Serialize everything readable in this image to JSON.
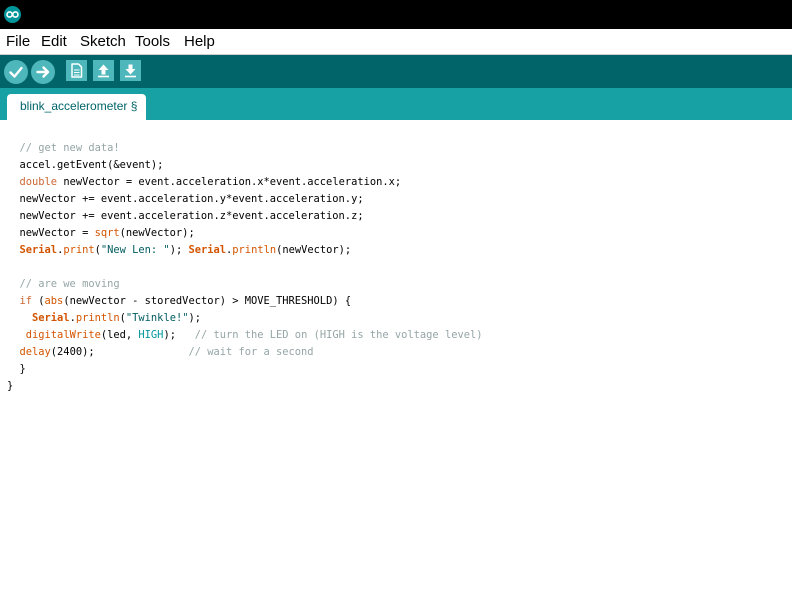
{
  "app": {
    "logo_icon": "arduino-infinity-logo-icon",
    "colors": {
      "toolbar": "#006468",
      "tabbar": "#17a1a5",
      "button": "#4db7bb",
      "keyword": "#cc6633",
      "comment": "#95a5a6",
      "string": "#005c5f",
      "constant": "#00979c"
    }
  },
  "menu": {
    "file": "File",
    "edit": "Edit",
    "sketch": "Sketch",
    "tools": "Tools",
    "help": "Help"
  },
  "toolbar": {
    "buttons": [
      {
        "name": "verify",
        "icon": "checkmark-icon"
      },
      {
        "name": "upload",
        "icon": "right-arrow-icon"
      },
      {
        "name": "new",
        "icon": "new-document-icon"
      },
      {
        "name": "open",
        "icon": "up-arrow-icon"
      },
      {
        "name": "save",
        "icon": "down-arrow-icon"
      }
    ]
  },
  "tab": {
    "label": "blink_accelerometer §"
  },
  "code": {
    "l1": {
      "a": "  // get new data!"
    },
    "l2": {
      "a": "  accel.getEvent(&event);"
    },
    "l3": {
      "a": "  ",
      "b": "double",
      "c": " newVector = event.acceleration.x*event.acceleration.x;"
    },
    "l4": {
      "a": "  newVector += event.acceleration.y*event.acceleration.y;"
    },
    "l5": {
      "a": "  newVector += event.acceleration.z*event.acceleration.z;"
    },
    "l6": {
      "a": "  newVector = ",
      "b": "sqrt",
      "c": "(newVector);"
    },
    "l7": {
      "a": "  ",
      "b": "Serial",
      "c": ".",
      "d": "print",
      "e": "(",
      "f": "\"New Len: \"",
      "g": "); ",
      "h": "Serial",
      "i": ".",
      "j": "println",
      "k": "(newVector);"
    },
    "l8": {
      "a": ""
    },
    "l9": {
      "a": "  // are we moving"
    },
    "l10": {
      "a": "  ",
      "b": "if",
      "c": " (",
      "d": "abs",
      "e": "(newVector - storedVector) > MOVE_THRESHOLD) {"
    },
    "l11": {
      "a": "    ",
      "b": "Serial",
      "c": ".",
      "d": "println",
      "e": "(",
      "f": "\"Twinkle!\"",
      "g": ");"
    },
    "l12": {
      "a": "   ",
      "b": "digitalWrite",
      "c": "(led, ",
      "d": "HIGH",
      "e": ");   ",
      "f": "// turn the LED on (HIGH is the voltage level)"
    },
    "l13": {
      "a": "  ",
      "b": "delay",
      "c": "(2400);               ",
      "d": "// wait for a second"
    },
    "l14": {
      "a": "  }"
    },
    "l15": {
      "a": "}"
    }
  }
}
